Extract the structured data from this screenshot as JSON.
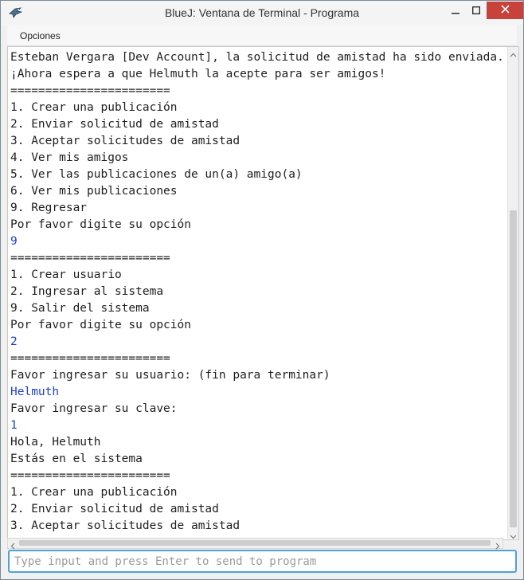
{
  "window": {
    "title": "BlueJ: Ventana de Terminal - Programa"
  },
  "menu": {
    "options_label": "Opciones"
  },
  "terminal": {
    "lines": [
      {
        "text": "Esteban Vergara [Dev Account], la solicitud de amistad ha sido enviada.",
        "user": false
      },
      {
        "text": "¡Ahora espera a que Helmuth la acepte para ser amigos!",
        "user": false
      },
      {
        "text": "=======================",
        "user": false
      },
      {
        "text": "1. Crear una publicación",
        "user": false
      },
      {
        "text": "2. Enviar solicitud de amistad",
        "user": false
      },
      {
        "text": "3. Aceptar solicitudes de amistad",
        "user": false
      },
      {
        "text": "4. Ver mis amigos",
        "user": false
      },
      {
        "text": "5. Ver las publicaciones de un(a) amigo(a)",
        "user": false
      },
      {
        "text": "6. Ver mis publicaciones",
        "user": false
      },
      {
        "text": "9. Regresar",
        "user": false
      },
      {
        "text": "Por favor digite su opción",
        "user": false
      },
      {
        "text": "9",
        "user": true
      },
      {
        "text": "=======================",
        "user": false
      },
      {
        "text": "1. Crear usuario",
        "user": false
      },
      {
        "text": "2. Ingresar al sistema",
        "user": false
      },
      {
        "text": "9. Salir del sistema",
        "user": false
      },
      {
        "text": "Por favor digite su opción",
        "user": false
      },
      {
        "text": "2",
        "user": true
      },
      {
        "text": "=======================",
        "user": false
      },
      {
        "text": "Favor ingresar su usuario: (fin para terminar)",
        "user": false
      },
      {
        "text": "Helmuth",
        "user": true
      },
      {
        "text": "Favor ingresar su clave:",
        "user": false
      },
      {
        "text": "1",
        "user": true
      },
      {
        "text": "Hola, Helmuth",
        "user": false
      },
      {
        "text": "Estás en el sistema",
        "user": false
      },
      {
        "text": "=======================",
        "user": false
      },
      {
        "text": "1. Crear una publicación",
        "user": false
      },
      {
        "text": "2. Enviar solicitud de amistad",
        "user": false
      },
      {
        "text": "3. Aceptar solicitudes de amistad",
        "user": false
      }
    ]
  },
  "input": {
    "placeholder": "Type input and press Enter to send to program",
    "value": ""
  },
  "colors": {
    "user_input": "#1d3fcf",
    "input_focus_border": "#4ba3d6",
    "close_button": "#c7423b"
  },
  "icons": {
    "app": "bluej-bird-icon",
    "minimize": "minimize-icon",
    "maximize": "maximize-icon",
    "close": "close-icon"
  }
}
